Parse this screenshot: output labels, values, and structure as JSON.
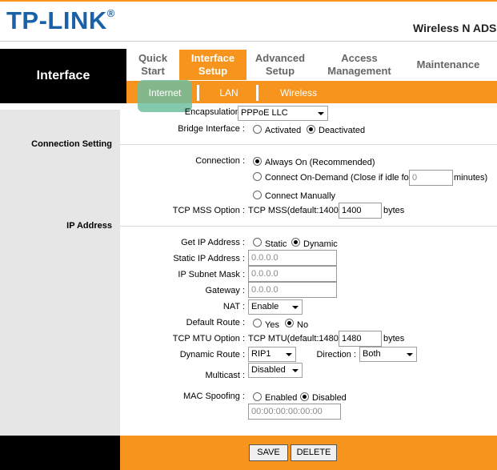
{
  "brand": {
    "logo": "TP-LINK",
    "registered": "®",
    "product": "Wireless N ADSL"
  },
  "sidebar": {
    "title": "Interface"
  },
  "nav": {
    "quick_start": [
      "Quick",
      "Start"
    ],
    "interface_setup": [
      "Interface",
      "Setup"
    ],
    "advanced_setup": [
      "Advanced",
      "Setup"
    ],
    "access_management": [
      "Access",
      "Management"
    ],
    "maintenance": "Maintenance"
  },
  "subnav": {
    "internet": "Internet",
    "lan": "LAN",
    "wireless": "Wireless"
  },
  "sections": {
    "connection_setting": "Connection Setting",
    "ip_address": "IP Address"
  },
  "form": {
    "encapsulation": {
      "label": "Encapsulation :",
      "value": "PPPoE LLC"
    },
    "bridge": {
      "label": "Bridge Interface :",
      "activated": "Activated",
      "deactivated": "Deactivated"
    },
    "connection": {
      "label": "Connection :",
      "always_on": "Always On (Recommended)",
      "on_demand": "Connect On-Demand (Close if idle for",
      "idle_value": "0",
      "minutes": "minutes)",
      "manually": "Connect Manually"
    },
    "tcp_mss": {
      "label": "TCP MSS Option :",
      "text": "TCP MSS(default:1400)",
      "value": "1400",
      "unit": "bytes"
    },
    "get_ip": {
      "label": "Get IP Address :",
      "static": "Static",
      "dynamic": "Dynamic"
    },
    "static_ip": {
      "label": "Static IP Address :",
      "placeholder": "0.0.0.0"
    },
    "subnet": {
      "label": "IP Subnet Mask :",
      "placeholder": "0.0.0.0"
    },
    "gateway": {
      "label": "Gateway :",
      "placeholder": "0.0.0.0"
    },
    "nat": {
      "label": "NAT :",
      "value": "Enable"
    },
    "default_route": {
      "label": "Default Route :",
      "yes": "Yes",
      "no": "No"
    },
    "tcp_mtu": {
      "label": "TCP MTU Option :",
      "text": "TCP MTU(default:1480)",
      "value": "1480",
      "unit": "bytes"
    },
    "dynamic_route": {
      "label": "Dynamic Route :",
      "value": "RIP1",
      "direction_label": "Direction :",
      "direction_value": "Both"
    },
    "multicast": {
      "label": "Multicast :",
      "value": "Disabled"
    },
    "mac_spoofing": {
      "label": "MAC Spoofing :",
      "enabled": "Enabled",
      "disabled": "Disabled",
      "placeholder": "00:00:00:00:00:00"
    }
  },
  "buttons": {
    "save": "SAVE",
    "delete": "DELETE"
  },
  "colors": {
    "accent": "#f7941e",
    "brand_blue": "#1a62a8",
    "highlight": "#6ebea0"
  }
}
